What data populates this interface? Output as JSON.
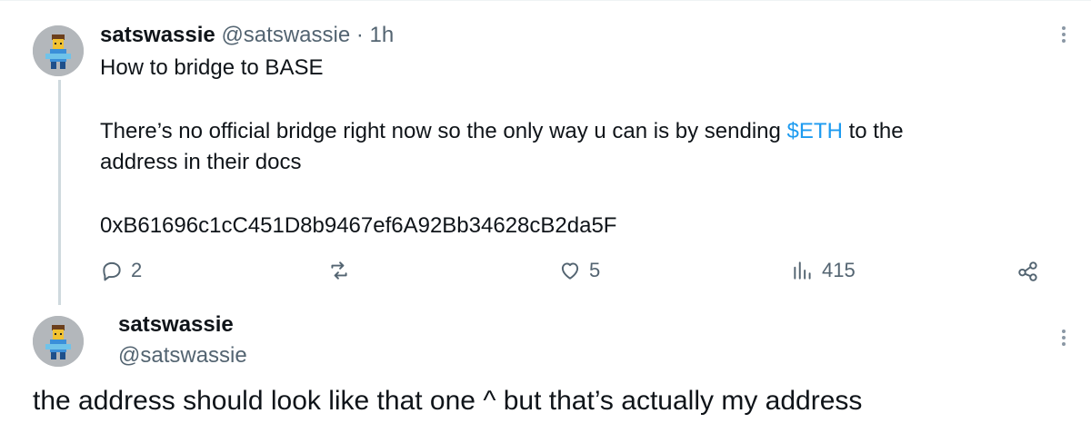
{
  "tweet": {
    "author_name": "satswassie",
    "handle": "@satswassie",
    "separator": "·",
    "time": "1h",
    "line1": "How to bridge to BASE",
    "line2_pre": "There’s no official bridge right now so the only way u can is by sending ",
    "cashtag": "$ETH",
    "line2_post": " to the",
    "line3": "address in their docs",
    "address": "0xB61696c1cC451D8b9467ef6A92Bb34628cB2da5F",
    "actions": {
      "replies": "2",
      "reposts": "",
      "likes": "5",
      "views": "415"
    }
  },
  "reply": {
    "author_name": "satswassie",
    "handle": "@satswassie",
    "text": "the address should look like that one ^ but that’s actually my address"
  },
  "colors": {
    "text": "#0f1419",
    "secondary": "#536471",
    "accent": "#1d9bf0",
    "thread_line": "#cfd9de"
  },
  "icons": [
    "avatar",
    "more-icon",
    "reply-icon",
    "repost-icon",
    "like-icon",
    "views-icon",
    "share-icon"
  ]
}
